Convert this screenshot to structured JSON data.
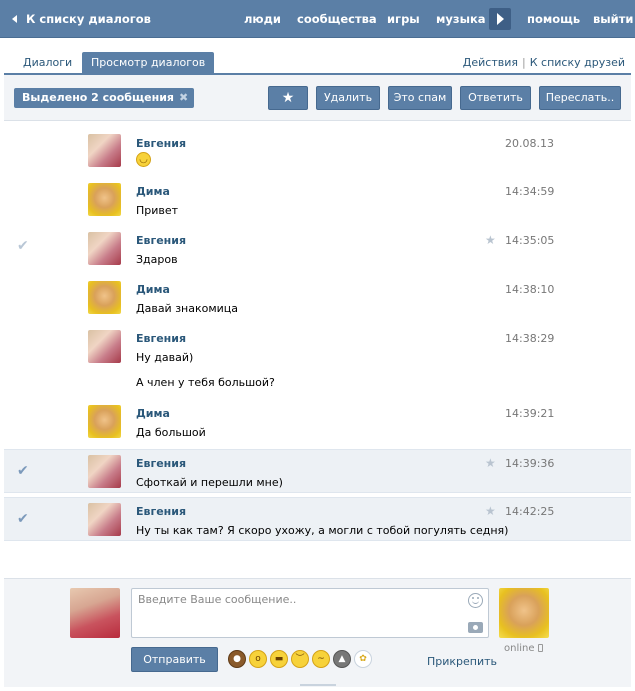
{
  "nav": {
    "back_label": "К списку диалогов",
    "items": [
      "люди",
      "сообщества",
      "игры",
      "музыка",
      "помощь",
      "выйти"
    ]
  },
  "tabs": {
    "items": [
      "Диалоги",
      "Просмотр диалогов"
    ],
    "links": [
      "Действия",
      "К списку друзей"
    ],
    "separator": "|"
  },
  "actionbar": {
    "selected_label": "Выделено 2 сообщения",
    "selected_close": "✖",
    "star_label": "★",
    "buttons": [
      "Удалить",
      "Это спам",
      "Ответить",
      "Переслать.."
    ]
  },
  "messages": [
    {
      "author": "Евгения",
      "lines": [
        "😄"
      ],
      "time": "20.08.13",
      "selected": false,
      "starred": false,
      "check": false
    },
    {
      "author": "Дима",
      "lines": [
        "Привет"
      ],
      "time": "14:34:59",
      "selected": false,
      "starred": false,
      "check": false
    },
    {
      "author": "Евгения",
      "lines": [
        "Здаров"
      ],
      "time": "14:35:05",
      "selected": false,
      "starred": true,
      "check": true
    },
    {
      "author": "Дима",
      "lines": [
        "Давай знакомица"
      ],
      "time": "14:38:10",
      "selected": false,
      "starred": false,
      "check": false
    },
    {
      "author": "Евгения",
      "lines": [
        "Ну давай)",
        "А член у тебя большой?"
      ],
      "time": "14:38:29",
      "selected": false,
      "starred": false,
      "check": false
    },
    {
      "author": "Дима",
      "lines": [
        "Да большой"
      ],
      "time": "14:39:21",
      "selected": false,
      "starred": false,
      "check": false
    },
    {
      "author": "Евгения",
      "lines": [
        "Сфоткай и перешли мне)"
      ],
      "time": "14:39:36",
      "selected": true,
      "starred": true,
      "check": true
    },
    {
      "author": "Евгения",
      "lines": [
        "Ну ты как там? Я скоро ухожу, а могли с тобой погулять седня)"
      ],
      "time": "14:42:25",
      "selected": true,
      "starred": true,
      "check": true
    }
  ],
  "compose": {
    "placeholder": "Введите Ваше сообщение..",
    "send_label": "Отправить",
    "attach_label": "Прикрепить",
    "online_label": "online",
    "emoji": [
      "🐞",
      "😳",
      "😁",
      "😔",
      "😕",
      "🐺",
      "🌼"
    ]
  },
  "colors": {
    "accent": "#5b7fa6",
    "link": "#2b587a",
    "selected_row": "#edf1f5"
  }
}
